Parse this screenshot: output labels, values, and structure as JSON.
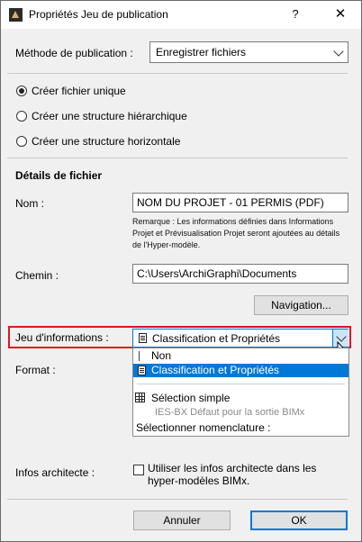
{
  "window": {
    "title": "Propriétés Jeu de publication",
    "help": "?",
    "close": "✕"
  },
  "publish_method": {
    "label": "Méthode de publication :",
    "value": "Enregistrer fichiers"
  },
  "structure": {
    "options": [
      "Créer fichier unique",
      "Créer une structure hiérarchique",
      "Créer une structure horizontale"
    ],
    "selected_index": 0
  },
  "file_details": {
    "heading": "Détails de fichier",
    "name_label": "Nom :",
    "name_value": "NOM DU PROJET - 01 PERMIS (PDF)",
    "note": "Remarque : Les informations définies dans Informations Projet et Prévisualisation Projet seront ajoutées au détails de l'Hyper-modèle.",
    "path_label": "Chemin :",
    "path_value": "C:\\Users\\ArchiGraphi\\Documents",
    "browse_button": "Navigation..."
  },
  "info_set": {
    "label": "Jeu d'informations :",
    "value": "Classification et Propriétés",
    "dropdown": {
      "item_none": "Non",
      "item_classification": "Classification et Propriétés",
      "item_simple": "Sélection simple",
      "item_ies": "IES-BX Défaut pour la sortie BIMx",
      "item_choose": "Sélectionner nomenclature :"
    }
  },
  "format": {
    "label": "Format :"
  },
  "architect": {
    "label": "Infos architecte :",
    "checkbox_text_1": "Utiliser les infos architecte dans les",
    "checkbox_text_2": "hyper-modèles BIMx.",
    "checked": false
  },
  "buttons": {
    "cancel": "Annuler",
    "ok": "OK"
  },
  "colors": {
    "highlight_border": "#e0151e",
    "selection": "#0078d7"
  }
}
